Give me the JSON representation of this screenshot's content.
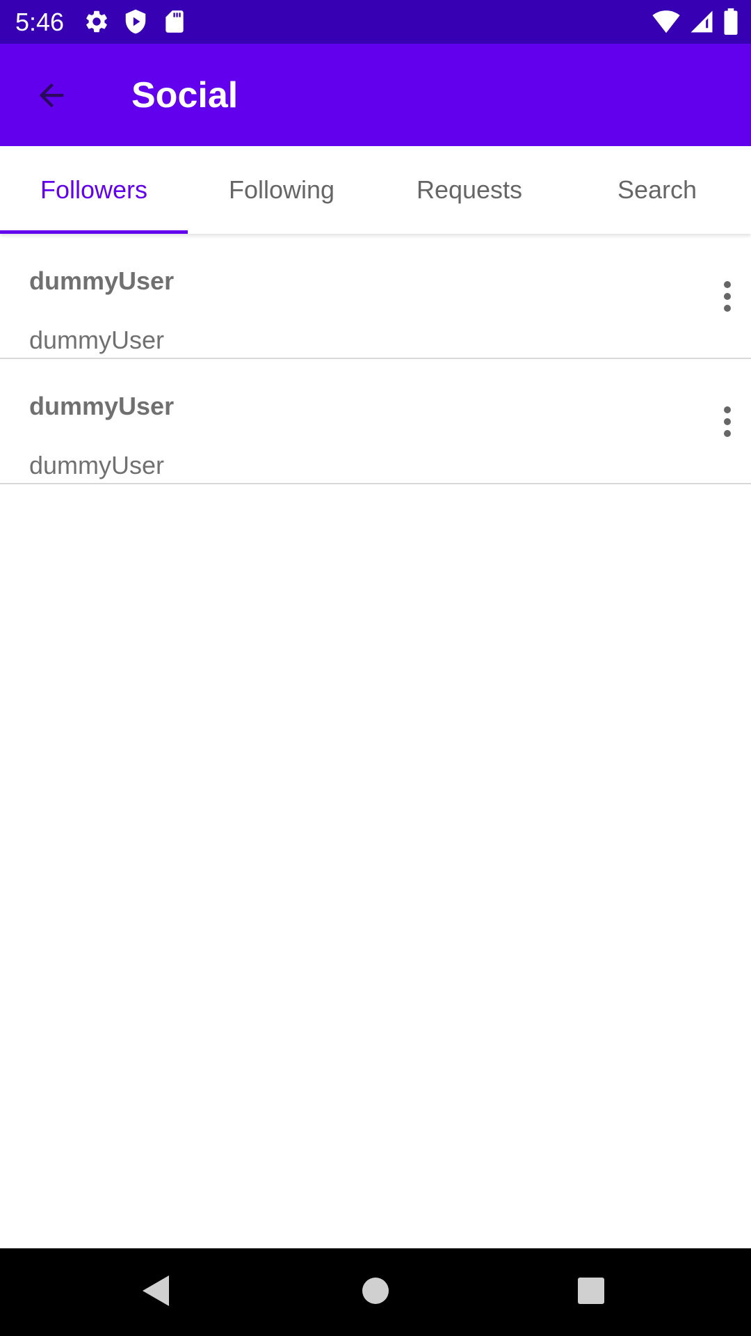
{
  "status_bar": {
    "time": "5:46",
    "left_icons": [
      "settings-icon",
      "shield-icon",
      "sd-card-icon"
    ],
    "right_icons": [
      "wifi-icon",
      "signal-icon",
      "battery-icon"
    ]
  },
  "app_bar": {
    "title": "Social",
    "back_icon": "arrow-back-icon"
  },
  "tabs": [
    {
      "label": "Followers",
      "active": true
    },
    {
      "label": "Following",
      "active": false
    },
    {
      "label": "Requests",
      "active": false
    },
    {
      "label": "Search",
      "active": false
    }
  ],
  "list": {
    "items": [
      {
        "title": "dummyUser",
        "subtitle": "dummyUser",
        "menu_icon": "more-vert-icon"
      },
      {
        "title": "dummyUser",
        "subtitle": "dummyUser",
        "menu_icon": "more-vert-icon"
      }
    ]
  },
  "nav_bar": {
    "buttons": [
      "back-triangle-icon",
      "home-circle-icon",
      "recents-square-icon"
    ]
  },
  "colors": {
    "status_bar": "#3700b3",
    "primary": "#6200ee",
    "tab_inactive": "#666666",
    "list_text": "#707070",
    "divider": "#d8d8d8"
  }
}
